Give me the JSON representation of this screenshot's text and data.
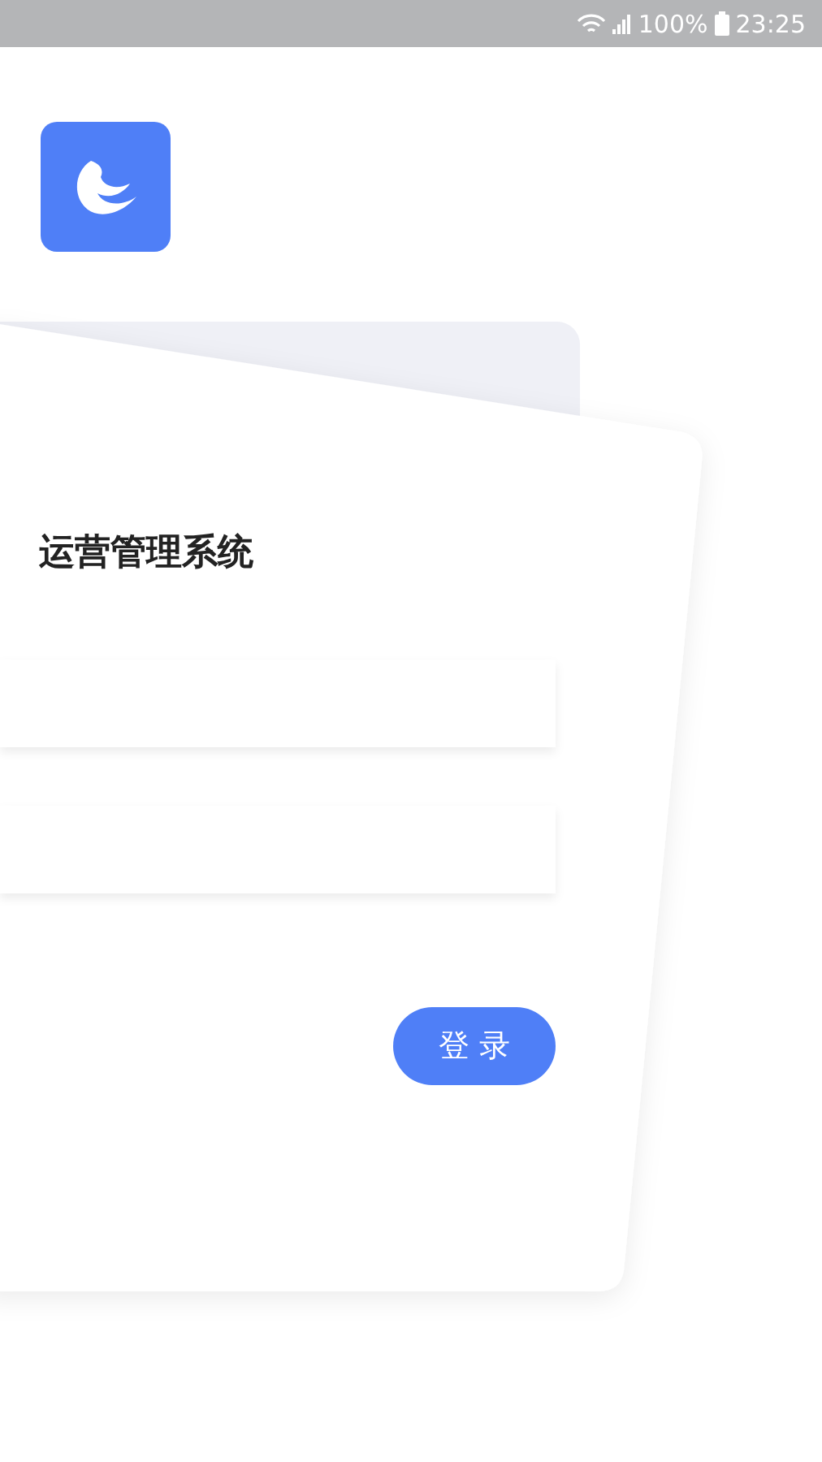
{
  "status_bar": {
    "battery": "100%",
    "time": "23:25"
  },
  "title": "运营管理系统",
  "login_button": "登 录"
}
